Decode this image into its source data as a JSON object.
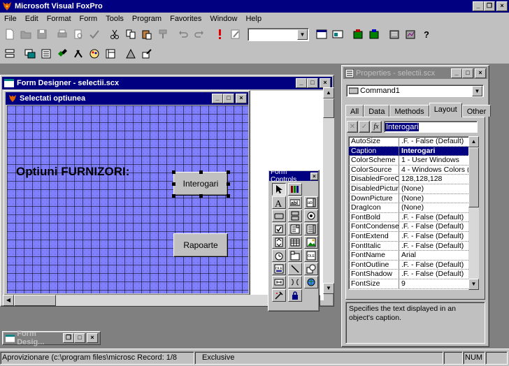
{
  "app": {
    "title": "Microsoft Visual FoxPro"
  },
  "menu": [
    "File",
    "Edit",
    "Format",
    "Form",
    "Tools",
    "Program",
    "Favorites",
    "Window",
    "Help"
  ],
  "toolbar": {
    "combo_value": ""
  },
  "form_designer": {
    "title": "Form Designer - selectii.scx"
  },
  "form": {
    "title": "Selectati optiunea",
    "label": "Optiuni FURNIZORI:",
    "button1": "Interogari",
    "button2": "Rapoarte"
  },
  "form_controls": {
    "title": "Form Controls"
  },
  "properties": {
    "title": "Properties - selectii.scx",
    "object": "Command1",
    "tabs": [
      "All",
      "Data",
      "Methods",
      "Layout",
      "Other"
    ],
    "active_tab": "Layout",
    "edit_value": "Interogari",
    "fx_label": "fx",
    "rows": [
      {
        "name": "AutoSize",
        "value": ".F. - False (Default)"
      },
      {
        "name": "Caption",
        "value": "Interogari"
      },
      {
        "name": "ColorScheme",
        "value": "1 - User Windows"
      },
      {
        "name": "ColorSource",
        "value": "4 - Windows Colors (D"
      },
      {
        "name": "DisabledForeCo",
        "value": "128,128,128"
      },
      {
        "name": "DisabledPicture",
        "value": "(None)"
      },
      {
        "name": "DownPicture",
        "value": "(None)"
      },
      {
        "name": "DragIcon",
        "value": "(None)"
      },
      {
        "name": "FontBold",
        "value": ".F. - False (Default)"
      },
      {
        "name": "FontCondense",
        "value": ".F. - False (Default)"
      },
      {
        "name": "FontExtend",
        "value": ".F. - False (Default)"
      },
      {
        "name": "FontItalic",
        "value": ".F. - False (Default)"
      },
      {
        "name": "FontName",
        "value": "Arial"
      },
      {
        "name": "FontOutline",
        "value": ".F. - False (Default)"
      },
      {
        "name": "FontShadow",
        "value": ".F. - False (Default)"
      },
      {
        "name": "FontSize",
        "value": "9"
      }
    ],
    "selected_row": 1,
    "description": "Specifies the text displayed in an object's caption."
  },
  "minimized": {
    "title": "Form Desig..."
  },
  "status": {
    "text": "Aprovizionare (c:\\program files\\microsc Record: 1/8",
    "mode": "Exclusive",
    "num": "NUM"
  },
  "colors": {
    "titlebar": "#000080",
    "canvas": "#8080ff",
    "face": "#c0c0c0"
  }
}
